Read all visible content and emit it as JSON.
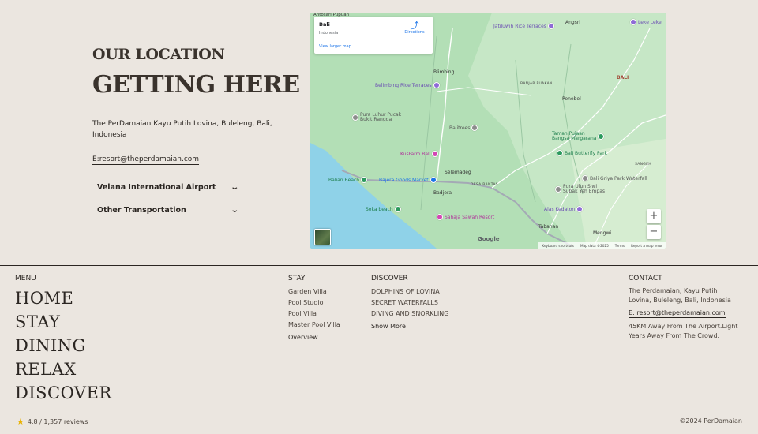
{
  "location": {
    "subtitle": "OUR LOCATION",
    "title": "GETTING HERE",
    "address": "The PerDamaian Kayu Putih Lovina, Buleleng, Bali, Indonesia",
    "email": "E:resort@theperdamaian.com",
    "accordions": [
      "Velana International Airport",
      "Other Transportation"
    ]
  },
  "map": {
    "card": {
      "place": "Bali",
      "region": "Indonesia",
      "larger": "View larger map",
      "directions": "Directions"
    },
    "labels": {
      "angsri": "Angsri",
      "leke": "Leke Leke",
      "blimbing": "Blimbing",
      "banjar": "BANJAR PUAKAN",
      "penebel": "Penebel",
      "bali": "BALI",
      "pura": "Pura Luhur Pucak\nBukit Rangda",
      "selemadeg": "Selemadeg",
      "desa": "DESA BANTAS",
      "badjera": "Badjera",
      "sangeh": "SANGEH",
      "tabanan": "Tabanan",
      "mengwi": "Mengwi",
      "antosari": "Antosari Pupuan"
    },
    "pois": {
      "jatiluwih": "Jatiluwih Rice Terraces",
      "belimbing": "Belimbing Rice Terraces",
      "balitrees": "Balitrees",
      "taman": "Taman Pujaan\nBangsa Margarana",
      "butterfly": "Bali Butterfly Park",
      "kusfarm": "KusFarm Bali",
      "bajera": "Bajera Goods Market",
      "balian": "Balian Beach",
      "pura_siwi": "Pura Ulun Siwi\nSubak Yeh Empas",
      "griya": "Bali Griya Park Waterfall",
      "alas": "Alas Kedaton",
      "soka": "Soka beach",
      "sahaja": "Sahaja Sawah Resort"
    },
    "zoom_in": "+",
    "zoom_out": "−",
    "google": "Google",
    "attribution": [
      "Keyboard shortcuts",
      "Map data ©2025",
      "Terms",
      "Report a map error"
    ]
  },
  "footer": {
    "menu_heading": "MENU",
    "menu": [
      "HOME",
      "STAY",
      "DINING",
      "RELAX",
      "DISCOVER"
    ],
    "stay_heading": "STAY",
    "stay": [
      "Garden Villa",
      "Pool Studio",
      "Pool Villa",
      "Master Pool Villa"
    ],
    "stay_more": "Overview",
    "discover_heading": "DISCOVER",
    "discover": [
      "DOLPHINS OF LOVINA",
      "SECRET WATERFALLS",
      "DIVING AND SNORKLING"
    ],
    "discover_more": "Show More",
    "contact_heading": "CONTACT",
    "contact_address": "The Perdamaian, Kayu Putih Lovina, Buleleng, Bali, Indonesia",
    "contact_email": "E: resort@theperdamaian.com",
    "contact_note": "45KM Away From The Airport.Light Years Away From The Crowd.",
    "rating": "4.8 / 1,357 reviews",
    "copyright": "©2024 PerDamaian"
  }
}
